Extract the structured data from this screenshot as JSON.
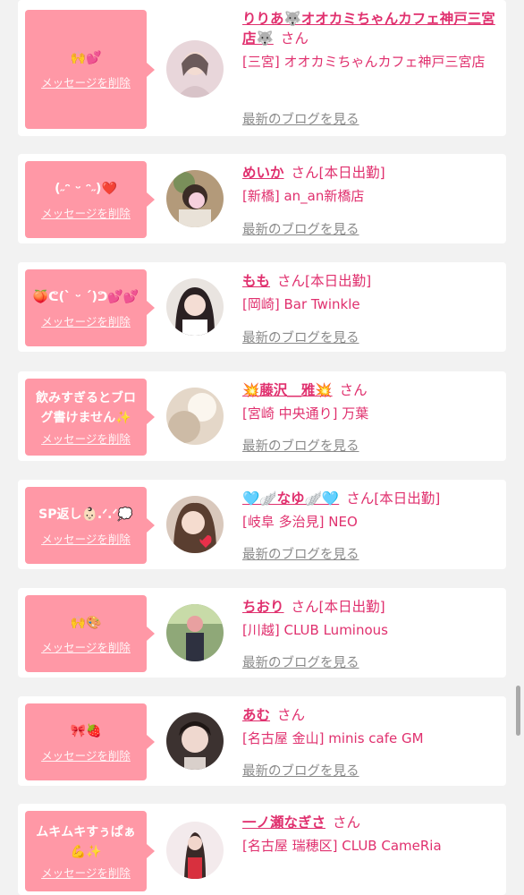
{
  "items": [
    {
      "message": "🙌💕",
      "delete_label": "メッセージを削除",
      "name": "りりあ🐺オオカミちゃんカフェ神戸三宮店🐺",
      "suffix": "さん",
      "status": "",
      "shop": "[三宮] オオカミちゃんカフェ神戸三宮店",
      "blog_label": "最新のブログを見る",
      "avatar_color": "#e6d2d6"
    },
    {
      "message": "(˶ᵔ ᵕ ᵔ˶)❤️",
      "delete_label": "メッセージを削除",
      "name": "めいか",
      "suffix": "さん",
      "status": "[本日出勤]",
      "shop": "[新橋] an_an新橋店",
      "blog_label": "最新のブログを見る",
      "avatar_color": "#c9a98d"
    },
    {
      "message": "🍑ᕦ(ˋ̀ ᵕ ˊ́)ᕤ💕💕",
      "delete_label": "メッセージを削除",
      "name": "もも",
      "suffix": "さん",
      "status": "[本日出勤]",
      "shop": "[岡崎] Bar Twinkle",
      "blog_label": "最新のブログを見る",
      "avatar_color": "#4a3a3a"
    },
    {
      "message": "飲みすぎるとブログ書けません✨",
      "delete_label": "メッセージを削除",
      "name": "💥藤沢＿雅💥",
      "suffix": "さん",
      "status": "",
      "shop": "[宮崎 中央通り] 万葉",
      "blog_label": "最新のブログを見る",
      "avatar_color": "#eadfd2"
    },
    {
      "message": "SP返し👶🏻‪‪.ᐟ‬.ᐟ‬💭",
      "delete_label": "メッセージを削除",
      "name": "🩵🪽なゆ🪽🩵",
      "suffix": "さん",
      "status": "[本日出勤]",
      "shop": "[岐阜 多治見] NEO",
      "blog_label": "最新のブログを見る",
      "avatar_color": "#b89a86"
    },
    {
      "message": "🙌🎨",
      "delete_label": "メッセージを削除",
      "name": "ちおり",
      "suffix": "さん",
      "status": "[本日出勤]",
      "shop": "[川越] CLUB Luminous",
      "blog_label": "最新のブログを見る",
      "avatar_color": "#7f9a6a"
    },
    {
      "message": "🎀🍓",
      "delete_label": "メッセージを削除",
      "name": "あむ",
      "suffix": "さん",
      "status": "",
      "shop": "[名古屋 金山] minis cafe GM",
      "blog_label": "最新のブログを見る",
      "avatar_color": "#5a4a44"
    },
    {
      "message": "ムキムキすぅぱぁ💪✨",
      "delete_label": "メッセージを削除",
      "name": "一ノ瀬なぎさ",
      "suffix": "さん",
      "status": "",
      "shop": "[名古屋 瑞穂区] CLUB CameRia",
      "blog_label": "最新のブログを見る",
      "avatar_color": "#f1e4e6"
    }
  ],
  "colors": {
    "accent": "#e0306e",
    "bubble": "#ff98a6",
    "background": "#f2f2f2"
  }
}
